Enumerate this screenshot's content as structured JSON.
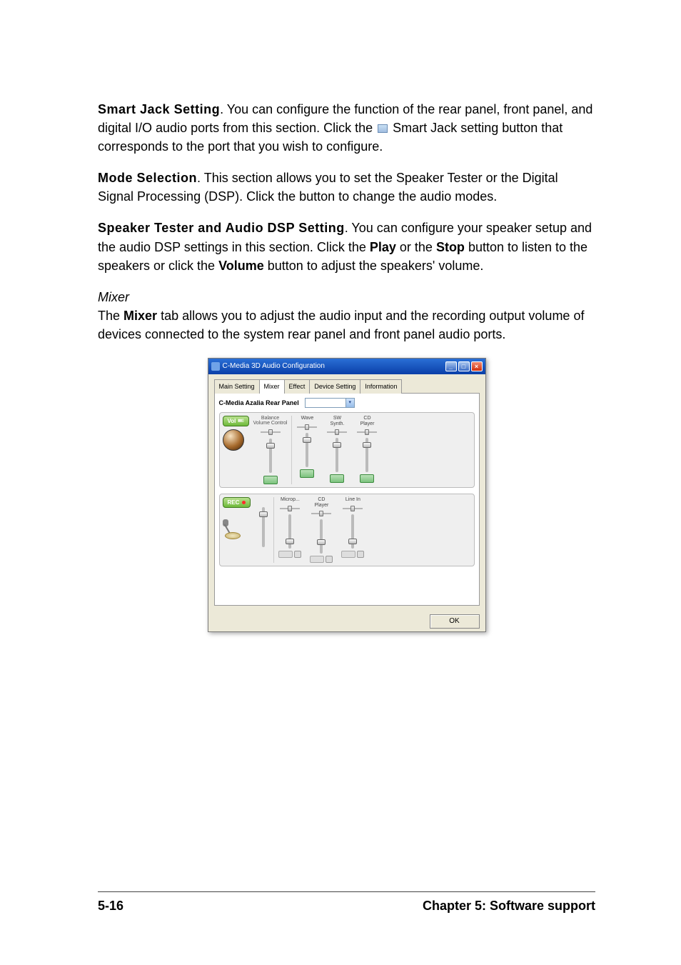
{
  "paragraphs": {
    "smart_jack_title": "Smart Jack Setting",
    "smart_jack_text1": ". You can configure the function of the rear panel, front panel, and digital I/O audio ports from this section. Click the ",
    "smart_jack_text2": " Smart Jack setting button that corresponds to the port that you wish to configure.",
    "mode_selection_title": "Mode Selection",
    "mode_selection_text": ". This section allows you to set the Speaker Tester or the Digital Signal Processing (DSP). Click the button to change the audio modes.",
    "speaker_tester_title": "Speaker Tester and Audio DSP Setting",
    "speaker_tester_text1": ". You can configure your speaker setup and the audio DSP settings in this section. Click the ",
    "play_label": "Play",
    "speaker_tester_text2": " or the ",
    "stop_label": "Stop",
    "speaker_tester_text3": " button to listen to the speakers or click the ",
    "volume_label": "Volume",
    "speaker_tester_text4": " button to adjust the speakers' volume.",
    "mixer_heading": "Mixer",
    "mixer_text1": "The ",
    "mixer_bold": "Mixer",
    "mixer_text2": " tab allows you to adjust the audio input and the recording output volume of devices connected to the system rear panel and front panel audio ports."
  },
  "dialog": {
    "title": "C-Media 3D Audio Configuration",
    "tabs": [
      "Main Setting",
      "Mixer",
      "Effect",
      "Device Setting",
      "Information"
    ],
    "active_tab": 1,
    "panel_label": "C-Media Azalia Rear Panel",
    "vol_pill": "Vol",
    "rec_pill": "REC",
    "balance_label": "Balance",
    "volume_control_label": "Volume Control",
    "play_channels": [
      {
        "label1": "Wave",
        "label2": ""
      },
      {
        "label1": "SW",
        "label2": "Synth."
      },
      {
        "label1": "CD",
        "label2": "Player"
      }
    ],
    "rec_channels": [
      {
        "label1": "Microp...",
        "label2": ""
      },
      {
        "label1": "CD",
        "label2": "Player"
      },
      {
        "label1": "Line In",
        "label2": ""
      }
    ],
    "ok_button": "OK"
  },
  "footer": {
    "page": "5-16",
    "chapter": "Chapter 5: Software support"
  }
}
